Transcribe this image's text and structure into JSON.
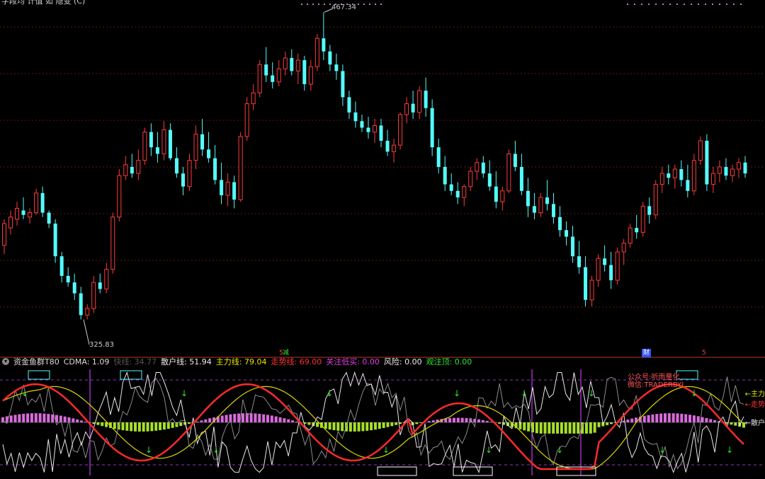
{
  "top_title": "字段均 计值 如 隐变 (C)",
  "price_high_label": "467.34",
  "price_low_label": "325.83",
  "markers": {
    "m1": "减",
    "m2": "财",
    "m3": "5",
    "m4": "5"
  },
  "indicator": {
    "name": "资金鱼群T80",
    "cdma": "CDMA: 1.09",
    "dim": "快线: 34.77",
    "sanhu": "散户线: 51.94",
    "zhuli": "主力线: 79.04",
    "zoushi": "走势线: 69.00",
    "guanzhu": "关注低买: 0.00",
    "fengxian": "风险: 0.00",
    "guanzhu2": "观注顶: 0.00"
  },
  "watermark": {
    "line1": "公众号:听雨量化",
    "line2": "微信:TRADERBYL"
  },
  "right_labels": {
    "zhuli": "←主力",
    "zoushi": "←走势",
    "sanhu": "←散户"
  },
  "colors": {
    "up": "#ff3b3b",
    "down": "#54fcfc",
    "red": "#ff2a2a",
    "yellow": "#d9d900",
    "white": "#e8e8e8",
    "grey": "#8a8a8a",
    "magenta": "#d86bdc",
    "lime": "#a8e02a",
    "purple": "#9b30c0",
    "cyan": "#54fcfc",
    "green": "#31e531"
  },
  "chart_data": {
    "type": "candlestick",
    "y_range": [
      320,
      470
    ],
    "candles": [
      [
        360,
        372,
        356,
        370
      ],
      [
        368,
        376,
        365,
        373
      ],
      [
        372,
        380,
        369,
        377
      ],
      [
        376,
        382,
        372,
        374
      ],
      [
        373,
        377,
        370,
        375
      ],
      [
        375,
        386,
        374,
        384
      ],
      [
        384,
        387,
        373,
        375
      ],
      [
        375,
        376,
        368,
        370
      ],
      [
        370,
        372,
        352,
        355
      ],
      [
        355,
        357,
        343,
        346
      ],
      [
        346,
        350,
        341,
        343
      ],
      [
        343,
        347,
        335,
        338
      ],
      [
        338,
        341,
        326,
        328
      ],
      [
        328,
        333,
        326,
        331
      ],
      [
        331,
        346,
        329,
        343
      ],
      [
        343,
        347,
        338,
        340
      ],
      [
        340,
        352,
        338,
        349
      ],
      [
        349,
        375,
        347,
        373
      ],
      [
        373,
        395,
        371,
        392
      ],
      [
        392,
        401,
        390,
        397
      ],
      [
        396,
        402,
        391,
        393
      ],
      [
        393,
        404,
        390,
        399
      ],
      [
        399,
        414,
        397,
        412
      ],
      [
        412,
        416,
        401,
        405
      ],
      [
        405,
        412,
        398,
        402
      ],
      [
        402,
        417,
        399,
        413
      ],
      [
        413,
        416,
        399,
        400
      ],
      [
        400,
        405,
        391,
        393
      ],
      [
        393,
        396,
        383,
        387
      ],
      [
        387,
        402,
        385,
        399
      ],
      [
        399,
        415,
        395,
        411
      ],
      [
        411,
        418,
        401,
        404
      ],
      [
        404,
        412,
        398,
        400
      ],
      [
        400,
        406,
        388,
        390
      ],
      [
        390,
        398,
        379,
        383
      ],
      [
        383,
        393,
        378,
        389
      ],
      [
        389,
        392,
        377,
        381
      ],
      [
        381,
        412,
        380,
        410
      ],
      [
        410,
        428,
        408,
        425
      ],
      [
        425,
        434,
        422,
        430
      ],
      [
        430,
        445,
        428,
        443
      ],
      [
        443,
        451,
        435,
        438
      ],
      [
        438,
        444,
        432,
        435
      ],
      [
        435,
        445,
        433,
        441
      ],
      [
        441,
        449,
        438,
        446
      ],
      [
        446,
        450,
        438,
        440
      ],
      [
        440,
        448,
        434,
        445
      ],
      [
        445,
        447,
        431,
        434
      ],
      [
        434,
        445,
        431,
        442
      ],
      [
        442,
        457,
        440,
        455
      ],
      [
        455,
        467,
        445,
        449
      ],
      [
        449,
        452,
        440,
        443
      ],
      [
        443,
        448,
        436,
        440
      ],
      [
        440,
        443,
        424,
        428
      ],
      [
        428,
        431,
        418,
        421
      ],
      [
        421,
        426,
        414,
        417
      ],
      [
        417,
        420,
        412,
        414
      ],
      [
        414,
        419,
        409,
        412
      ],
      [
        412,
        418,
        407,
        415
      ],
      [
        415,
        418,
        405,
        408
      ],
      [
        408,
        413,
        401,
        403
      ],
      [
        403,
        409,
        398,
        406
      ],
      [
        406,
        421,
        404,
        420
      ],
      [
        420,
        428,
        416,
        425
      ],
      [
        425,
        431,
        418,
        421
      ],
      [
        421,
        433,
        418,
        431
      ],
      [
        431,
        437,
        419,
        423
      ],
      [
        423,
        427,
        401,
        405
      ],
      [
        405,
        409,
        393,
        396
      ],
      [
        396,
        401,
        385,
        388
      ],
      [
        388,
        393,
        383,
        385
      ],
      [
        385,
        389,
        379,
        382
      ],
      [
        382,
        388,
        378,
        387
      ],
      [
        387,
        396,
        385,
        394
      ],
      [
        394,
        400,
        390,
        398
      ],
      [
        398,
        401,
        391,
        393
      ],
      [
        393,
        399,
        385,
        387
      ],
      [
        387,
        394,
        377,
        380
      ],
      [
        380,
        387,
        376,
        385
      ],
      [
        385,
        404,
        384,
        402
      ],
      [
        402,
        408,
        394,
        396
      ],
      [
        396,
        402,
        383,
        385
      ],
      [
        385,
        391,
        373,
        378
      ],
      [
        378,
        384,
        372,
        375
      ],
      [
        375,
        384,
        373,
        382
      ],
      [
        382,
        390,
        376,
        379
      ],
      [
        379,
        384,
        370,
        373
      ],
      [
        373,
        378,
        364,
        367
      ],
      [
        367,
        371,
        360,
        364
      ],
      [
        364,
        369,
        352,
        355
      ],
      [
        355,
        362,
        347,
        350
      ],
      [
        350,
        355,
        332,
        335
      ],
      [
        335,
        346,
        332,
        344
      ],
      [
        344,
        356,
        341,
        354
      ],
      [
        354,
        360,
        348,
        351
      ],
      [
        351,
        357,
        340,
        344
      ],
      [
        344,
        359,
        342,
        357
      ],
      [
        357,
        363,
        351,
        361
      ],
      [
        361,
        370,
        359,
        368
      ],
      [
        368,
        374,
        363,
        366
      ],
      [
        366,
        380,
        364,
        378
      ],
      [
        378,
        382,
        370,
        374
      ],
      [
        374,
        390,
        372,
        388
      ],
      [
        388,
        396,
        384,
        393
      ],
      [
        393,
        397,
        388,
        391
      ],
      [
        391,
        397,
        386,
        395
      ],
      [
        395,
        399,
        387,
        390
      ],
      [
        390,
        397,
        382,
        385
      ],
      [
        385,
        402,
        383,
        399
      ],
      [
        399,
        410,
        397,
        408
      ],
      [
        408,
        411,
        385,
        388
      ],
      [
        388,
        396,
        384,
        393
      ],
      [
        393,
        399,
        389,
        396
      ],
      [
        396,
        400,
        390,
        392
      ],
      [
        392,
        397,
        389,
        395
      ],
      [
        395,
        400,
        391,
        398
      ],
      [
        398,
        401,
        391,
        393
      ]
    ]
  }
}
